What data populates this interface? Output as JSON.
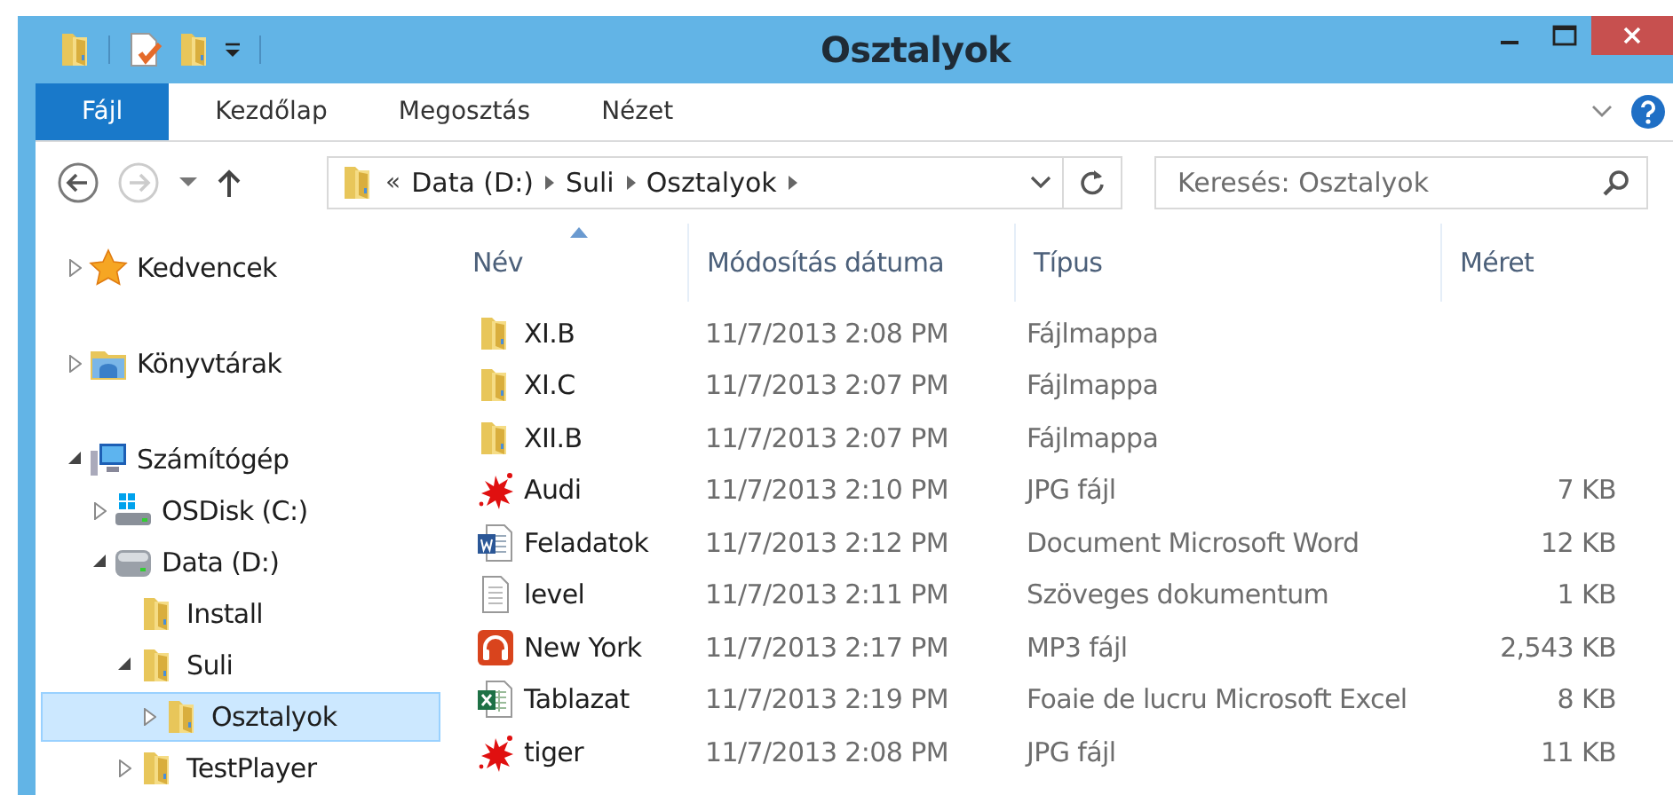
{
  "window": {
    "title": "Osztalyok"
  },
  "quick_access": [
    {
      "kind": "folder"
    },
    {
      "kind": "properties"
    },
    {
      "kind": "newfolder"
    },
    {
      "kind": "customize"
    }
  ],
  "ribbon_tabs": [
    {
      "label": "Fájl",
      "kind": "file"
    },
    {
      "label": "Kezdőlap",
      "kind": "tab"
    },
    {
      "label": "Megosztás",
      "kind": "tab"
    },
    {
      "label": "Nézet",
      "kind": "tab"
    }
  ],
  "address": {
    "overflow": "«",
    "crumbs": [
      "Data (D:)",
      "Suli",
      "Osztalyok"
    ]
  },
  "search": {
    "placeholder": "Keresés: Osztalyok"
  },
  "tree": [
    {
      "label": "Kedvencek",
      "kind": "star",
      "expandable": true,
      "expanded": false,
      "selected": false
    },
    {
      "label": "Könyvtárak",
      "kind": "library",
      "expandable": true,
      "expanded": false,
      "selected": false
    },
    {
      "label": "Számítógép",
      "kind": "computer",
      "expandable": true,
      "expanded": true,
      "selected": false,
      "children": [
        {
          "label": "OSDisk (C:)",
          "kind": "osdisk",
          "expandable": true,
          "expanded": false,
          "selected": false
        },
        {
          "label": "Data (D:)",
          "kind": "drive",
          "expandable": true,
          "expanded": true,
          "selected": false,
          "children": [
            {
              "label": "Install",
              "kind": "folder",
              "expandable": false,
              "selected": false
            },
            {
              "label": "Suli",
              "kind": "folder",
              "expandable": true,
              "expanded": true,
              "selected": false,
              "children": [
                {
                  "label": "Osztalyok",
                  "kind": "folder",
                  "expandable": true,
                  "expanded": false,
                  "selected": true
                }
              ]
            },
            {
              "label": "TestPlayer",
              "kind": "folder",
              "expandable": true,
              "expanded": false,
              "selected": false
            }
          ]
        }
      ]
    }
  ],
  "columns": [
    {
      "label": "Név",
      "sorted": true
    },
    {
      "label": "Módosítás dátuma",
      "sorted": false
    },
    {
      "label": "Típus",
      "sorted": false
    },
    {
      "label": "Méret",
      "sorted": false
    }
  ],
  "files": [
    {
      "name": "XI.B",
      "kind": "folder",
      "date": "11/7/2013 2:08 PM",
      "type": "Fájlmappa"
    },
    {
      "name": "XI.C",
      "kind": "folder",
      "date": "11/7/2013 2:07 PM",
      "type": "Fájlmappa"
    },
    {
      "name": "XII.B",
      "kind": "folder",
      "date": "11/7/2013 2:07 PM",
      "type": "Fájlmappa"
    },
    {
      "name": "Audi",
      "kind": "image",
      "date": "11/7/2013 2:10 PM",
      "type": "JPG fájl",
      "size": "7 KB"
    },
    {
      "name": "Feladatok",
      "kind": "word",
      "date": "11/7/2013 2:12 PM",
      "type": "Document Microsoft Word",
      "size": "12 KB"
    },
    {
      "name": "level",
      "kind": "text",
      "date": "11/7/2013 2:11 PM",
      "type": "Szöveges dokumentum",
      "size": "1 KB"
    },
    {
      "name": "New York",
      "kind": "audio",
      "date": "11/7/2013 2:17 PM",
      "type": "MP3 fájl",
      "size": "2,543 KB"
    },
    {
      "name": "Tablazat",
      "kind": "excel",
      "date": "11/7/2013 2:19 PM",
      "type": "Foaie de lucru Microsoft Excel",
      "size": "8 KB"
    },
    {
      "name": "tiger",
      "kind": "image",
      "date": "11/7/2013 2:08 PM",
      "type": "JPG fájl",
      "size": "11 KB"
    }
  ]
}
